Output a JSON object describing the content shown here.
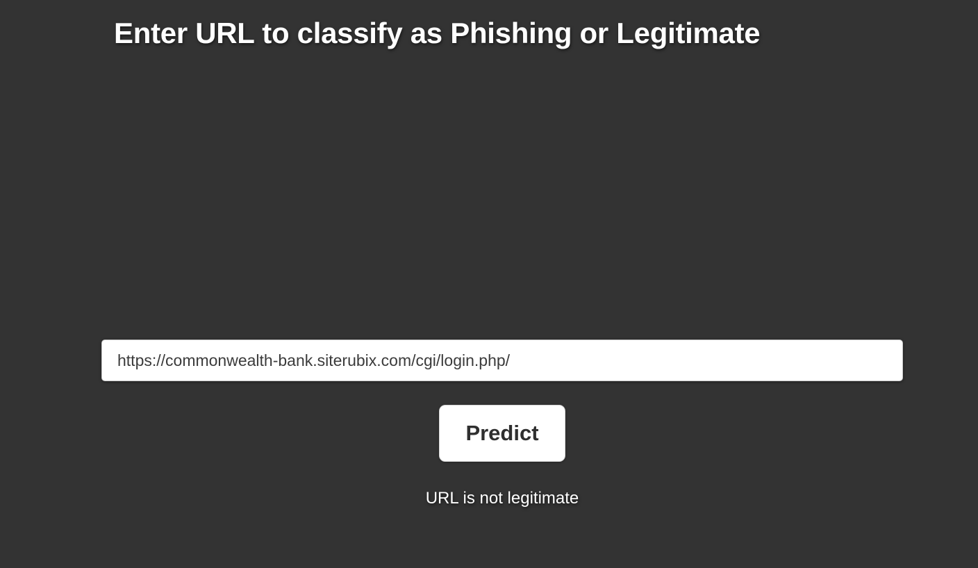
{
  "page": {
    "title": "Enter URL to classify as Phishing or Legitimate",
    "background_color": "#333333"
  },
  "form": {
    "url_value": "https://commonwealth-bank.siterubix.com/cgi/login.php/",
    "predict_label": "Predict"
  },
  "result": {
    "message": "URL is not legitimate"
  }
}
